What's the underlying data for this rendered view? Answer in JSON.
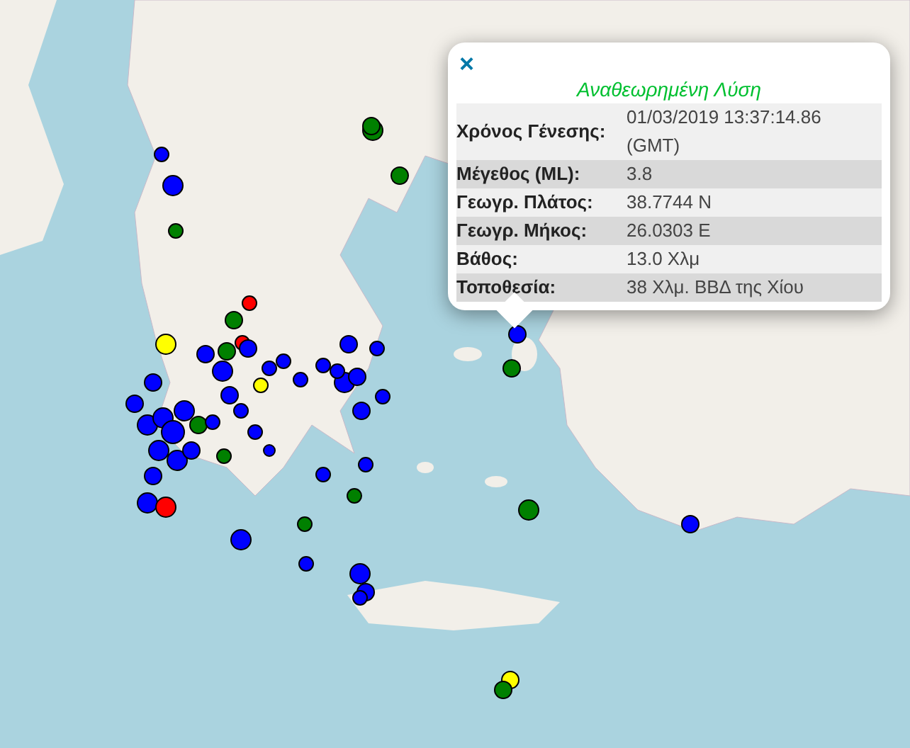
{
  "popup": {
    "close": "×",
    "title": "Αναθεωρημένη Λύση",
    "rows": [
      {
        "label": "Χρόνος Γένεσης:",
        "value": "01/03/2019 13:37:14.86 (GMT)"
      },
      {
        "label": "Μέγεθος (ML):",
        "value": "3.8"
      },
      {
        "label": "Γεωγρ. Πλάτος:",
        "value": "38.7744 N"
      },
      {
        "label": "Γεωγρ. Μήκος:",
        "value": "26.0303 E"
      },
      {
        "label": "Βάθος:",
        "value": "13.0 Χλμ"
      },
      {
        "label": "Τοποθεσία:",
        "value": "38 Χλμ. ΒΒΔ της Χίου"
      }
    ]
  }
}
